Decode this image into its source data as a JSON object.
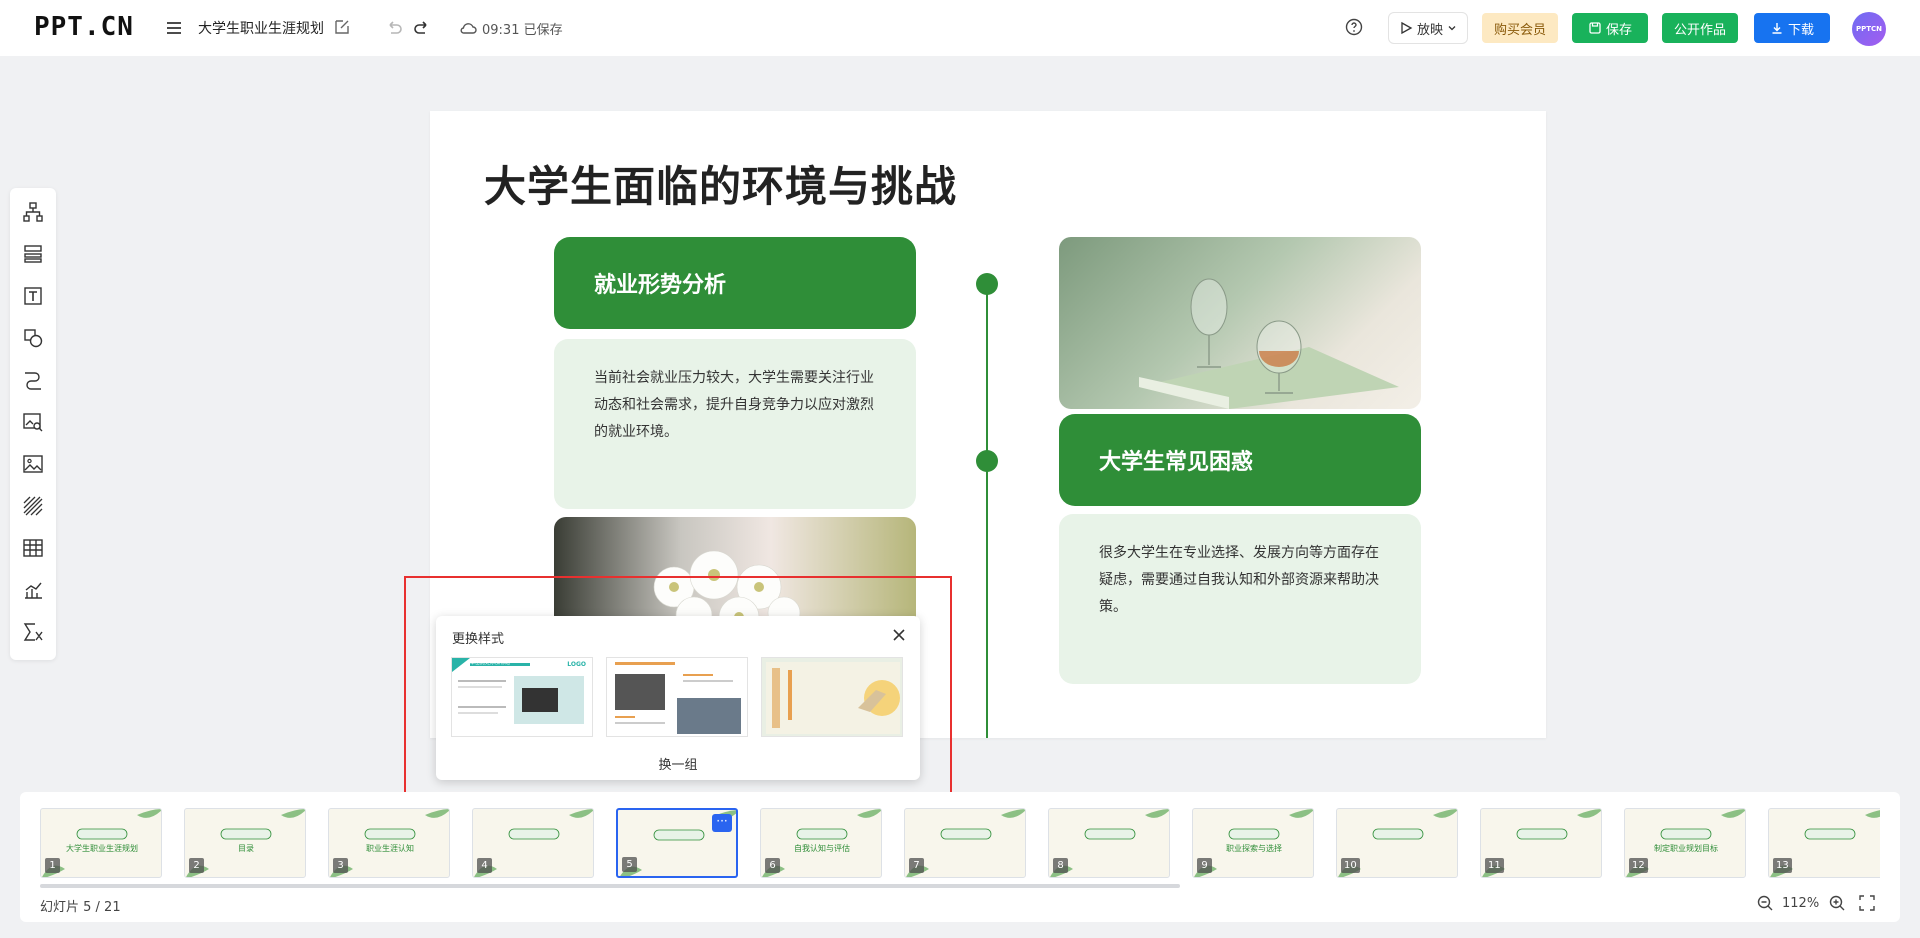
{
  "app": {
    "logo": "PPT.CN",
    "doc_title": "大学生职业生涯规划",
    "save_status": "09:31 已保存"
  },
  "toolbar": {
    "play_label": "放映",
    "vip_label": "购买会员",
    "save_label": "保存",
    "publish_label": "公开作品",
    "download_label": "下载",
    "avatar_text": "PPTCN"
  },
  "left_tools": [
    "org-chart-icon",
    "layout-icon",
    "text-icon",
    "shape-icon",
    "connector-icon",
    "image-search-icon",
    "image-icon",
    "pattern-icon",
    "table-icon",
    "chart-icon",
    "formula-icon"
  ],
  "slide": {
    "title": "大学生面临的环境与挑战",
    "section1": {
      "heading": "就业形势分析",
      "body": "当前社会就业压力较大，大学生需要关注行业动态和社会需求，提升自身竞争力以应对激烈的就业环境。"
    },
    "section2": {
      "heading": "大学生常见困惑",
      "body": "很多大学生在专业选择、发展方向等方面存在疑虑，需要通过自我认知和外部资源来帮助决策。"
    }
  },
  "style_popup": {
    "title": "更换样式",
    "shuffle_label": "换一组",
    "option1_heading": "单击此处添加标题",
    "option1_logo": "LOGO"
  },
  "thumbnails": [
    {
      "num": "1",
      "text": "大学生职业生涯规划"
    },
    {
      "num": "2",
      "text": "目录"
    },
    {
      "num": "3",
      "text": "职业生涯认知"
    },
    {
      "num": "4",
      "text": ""
    },
    {
      "num": "5",
      "text": ""
    },
    {
      "num": "6",
      "text": "自我认知与评估"
    },
    {
      "num": "7",
      "text": ""
    },
    {
      "num": "8",
      "text": ""
    },
    {
      "num": "9",
      "text": "职业探索与选择"
    },
    {
      "num": "10",
      "text": ""
    },
    {
      "num": "11",
      "text": ""
    },
    {
      "num": "12",
      "text": "制定职业规划目标"
    },
    {
      "num": "13",
      "text": ""
    }
  ],
  "status": {
    "slide_count": "幻灯片 5 / 21",
    "zoom": "112%"
  },
  "colors": {
    "accent_green": "#2f8e38",
    "card_bg": "#e8f3e8",
    "highlight_red": "#e8302f",
    "brand_blue": "#1773f0",
    "save_green": "#19b25b"
  }
}
